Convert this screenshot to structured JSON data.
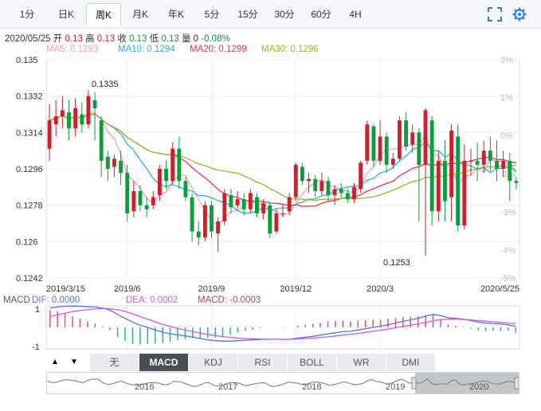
{
  "tabs": [
    {
      "label": "1分"
    },
    {
      "label": "日K"
    },
    {
      "label": "周K",
      "active": true
    },
    {
      "label": "月K"
    },
    {
      "label": "年K"
    },
    {
      "label": "5分"
    },
    {
      "label": "15分"
    },
    {
      "label": "30分"
    },
    {
      "label": "60分"
    },
    {
      "label": "4H"
    }
  ],
  "icons": {
    "fullscreen": "expand-icon",
    "settings": "gear-icon"
  },
  "info": {
    "date": "2020/05/25",
    "open_label": "开",
    "open": "0.13",
    "high_label": "高",
    "high": "0.13",
    "close_label": "收",
    "close": "0.13",
    "low_label": "低",
    "low": "0.13",
    "vol_label": "量",
    "vol": "0",
    "change": "-0.08%"
  },
  "ma_legend": [
    {
      "text": "MA5: 0.1293",
      "color": "#f0a0b8"
    },
    {
      "text": "MA10: 0.1294",
      "color": "#2bb3d9"
    },
    {
      "text": "MA20: 0.1299",
      "color": "#e0385a"
    },
    {
      "text": "MA30: 0.1296",
      "color": "#9ab82e"
    }
  ],
  "macd_legend": [
    {
      "text": "MACD",
      "color": "#555555"
    },
    {
      "text": "DIF: 0.0000",
      "color": "#5b6ee0"
    },
    {
      "text": "DEA: 0.0002",
      "color": "#d75bd6"
    },
    {
      "text": "MACD: -0.0003",
      "color": "#b5455b"
    }
  ],
  "chart_data": {
    "type": "candlestick",
    "period": "weekly",
    "ylim": [
      0.1242,
      0.135
    ],
    "y_ticks": [
      "0.135",
      "0.1332",
      "0.1314",
      "0.1296",
      "0.1278",
      "0.126",
      "0.1242"
    ],
    "pct_ticks": [
      "3%",
      "1%",
      "0%",
      "-1%",
      "-3%",
      "-4%",
      "-5%"
    ],
    "x_ticks": [
      "2019/3/15",
      "2019/6",
      "2019/9",
      "2019/12",
      "2020/3",
      "2020/5/25"
    ],
    "x_tick_index": [
      0,
      12,
      25,
      38,
      51,
      63
    ],
    "annotations": [
      {
        "text": "0.1335",
        "index": 6,
        "value": 0.1335
      },
      {
        "text": "0.1253",
        "index": 51,
        "value": 0.1253
      }
    ],
    "candles": [
      [
        0.1306,
        0.132,
        0.1328,
        0.13
      ],
      [
        0.1318,
        0.1322,
        0.133,
        0.1312
      ],
      [
        0.1322,
        0.1325,
        0.1332,
        0.1316
      ],
      [
        0.1324,
        0.1316,
        0.133,
        0.131
      ],
      [
        0.1316,
        0.1326,
        0.1331,
        0.1312
      ],
      [
        0.1323,
        0.1318,
        0.1329,
        0.1314
      ],
      [
        0.1318,
        0.1332,
        0.1335,
        0.1316
      ],
      [
        0.133,
        0.1326,
        0.1334,
        0.131
      ],
      [
        0.132,
        0.13,
        0.1322,
        0.1292
      ],
      [
        0.1302,
        0.1296,
        0.1305,
        0.129
      ],
      [
        0.1297,
        0.1301,
        0.1303,
        0.1292
      ],
      [
        0.13,
        0.1294,
        0.1305,
        0.1288
      ],
      [
        0.1294,
        0.1274,
        0.1298,
        0.127
      ],
      [
        0.1275,
        0.1285,
        0.129,
        0.1272
      ],
      [
        0.1285,
        0.1278,
        0.1288,
        0.1275
      ],
      [
        0.1278,
        0.1276,
        0.1282,
        0.1272
      ],
      [
        0.1278,
        0.1282,
        0.1285,
        0.1276
      ],
      [
        0.1283,
        0.1296,
        0.1298,
        0.128
      ],
      [
        0.1296,
        0.129,
        0.13,
        0.1286
      ],
      [
        0.129,
        0.1306,
        0.1309,
        0.1288
      ],
      [
        0.1306,
        0.129,
        0.1312,
        0.1286
      ],
      [
        0.129,
        0.1282,
        0.1292,
        0.128
      ],
      [
        0.1282,
        0.1265,
        0.1284,
        0.126
      ],
      [
        0.1265,
        0.1262,
        0.127,
        0.1258
      ],
      [
        0.1262,
        0.1278,
        0.128,
        0.126
      ],
      [
        0.1278,
        0.1265,
        0.128,
        0.1262
      ],
      [
        0.1264,
        0.127,
        0.1272,
        0.1255
      ],
      [
        0.127,
        0.1284,
        0.1286,
        0.1268
      ],
      [
        0.1283,
        0.1277,
        0.1286,
        0.1274
      ],
      [
        0.1278,
        0.1281,
        0.1285,
        0.1276
      ],
      [
        0.1281,
        0.1276,
        0.1284,
        0.1273
      ],
      [
        0.1276,
        0.1284,
        0.1286,
        0.1274
      ],
      [
        0.1282,
        0.1274,
        0.1284,
        0.1272
      ],
      [
        0.1274,
        0.1279,
        0.1281,
        0.1271
      ],
      [
        0.1278,
        0.1264,
        0.128,
        0.1262
      ],
      [
        0.1265,
        0.1274,
        0.1276,
        0.1264
      ],
      [
        0.1274,
        0.1274,
        0.1278,
        0.1272
      ],
      [
        0.1275,
        0.1282,
        0.1284,
        0.1273
      ],
      [
        0.1282,
        0.1298,
        0.1299,
        0.128
      ],
      [
        0.1297,
        0.129,
        0.1299,
        0.1288
      ],
      [
        0.129,
        0.1291,
        0.1294,
        0.1284
      ],
      [
        0.1291,
        0.1285,
        0.1293,
        0.1282
      ],
      [
        0.1285,
        0.129,
        0.1294,
        0.1283
      ],
      [
        0.129,
        0.1283,
        0.1292,
        0.128
      ],
      [
        0.1283,
        0.1286,
        0.1288,
        0.1278
      ],
      [
        0.1286,
        0.1284,
        0.1289,
        0.1282
      ],
      [
        0.1284,
        0.1281,
        0.1286,
        0.1279
      ],
      [
        0.1281,
        0.1287,
        0.1289,
        0.1279
      ],
      [
        0.1286,
        0.1299,
        0.13,
        0.1284
      ],
      [
        0.13,
        0.1318,
        0.132,
        0.1298
      ],
      [
        0.1317,
        0.13,
        0.1318,
        0.1297
      ],
      [
        0.13,
        0.1312,
        0.132,
        0.1298
      ],
      [
        0.1312,
        0.1298,
        0.1314,
        0.1294
      ],
      [
        0.1298,
        0.1301,
        0.1304,
        0.1296
      ],
      [
        0.1301,
        0.132,
        0.1322,
        0.13
      ],
      [
        0.132,
        0.1307,
        0.1324,
        0.1305
      ],
      [
        0.1308,
        0.1314,
        0.1318,
        0.1304
      ],
      [
        0.1314,
        0.1298,
        0.1316,
        0.127
      ],
      [
        0.1298,
        0.1325,
        0.1326,
        0.1253
      ],
      [
        0.132,
        0.1275,
        0.1322,
        0.1268
      ],
      [
        0.1275,
        0.13,
        0.1305,
        0.127
      ],
      [
        0.13,
        0.128,
        0.131,
        0.127
      ],
      [
        0.1282,
        0.1315,
        0.1318,
        0.127
      ],
      [
        0.1312,
        0.1268,
        0.1318,
        0.1265
      ],
      [
        0.1268,
        0.13,
        0.1308,
        0.1266
      ],
      [
        0.13,
        0.13,
        0.1306,
        0.1293
      ],
      [
        0.13,
        0.1298,
        0.1309,
        0.129
      ],
      [
        0.1298,
        0.1305,
        0.131,
        0.1294
      ],
      [
        0.1305,
        0.13,
        0.1312,
        0.1295
      ],
      [
        0.13,
        0.1296,
        0.131,
        0.129
      ],
      [
        0.1296,
        0.13,
        0.1305,
        0.1292
      ],
      [
        0.13,
        0.129,
        0.1304,
        0.128
      ],
      [
        0.129,
        0.1289,
        0.1292,
        0.1286
      ]
    ],
    "macd": {
      "ylim": [
        -1,
        1
      ],
      "y_ticks": [
        "1",
        "-1"
      ],
      "dif": [
        0.9,
        0.95,
        0.98,
        0.99,
        0.98,
        0.96,
        0.95,
        0.9,
        0.8,
        0.6,
        0.42,
        0.25,
        0.1,
        0.0,
        -0.12,
        -0.22,
        -0.3,
        -0.35,
        -0.4,
        -0.45,
        -0.52,
        -0.58,
        -0.62,
        -0.64,
        -0.64,
        -0.62,
        -0.6,
        -0.58,
        -0.56,
        -0.55,
        -0.55,
        -0.56,
        -0.55,
        -0.5,
        -0.46,
        -0.42,
        -0.36,
        -0.3,
        -0.25,
        -0.2,
        -0.18,
        -0.12,
        -0.06,
        0.0,
        0.05,
        0.12,
        0.2,
        0.28,
        0.35,
        0.42,
        0.52,
        0.6,
        0.55,
        0.45,
        0.42,
        0.38,
        0.32,
        0.25,
        0.2,
        0.18,
        0.15,
        0.12,
        0.05
      ],
      "dea": [
        0.5,
        0.58,
        0.66,
        0.73,
        0.78,
        0.82,
        0.86,
        0.88,
        0.86,
        0.82,
        0.74,
        0.63,
        0.5,
        0.38,
        0.26,
        0.14,
        0.04,
        -0.05,
        -0.13,
        -0.2,
        -0.27,
        -0.33,
        -0.38,
        -0.43,
        -0.47,
        -0.5,
        -0.52,
        -0.53,
        -0.54,
        -0.55,
        -0.55,
        -0.55,
        -0.55,
        -0.54,
        -0.52,
        -0.5,
        -0.47,
        -0.44,
        -0.4,
        -0.36,
        -0.32,
        -0.28,
        -0.23,
        -0.18,
        -0.13,
        -0.08,
        -0.02,
        0.04,
        0.1,
        0.16,
        0.23,
        0.3,
        0.36,
        0.38,
        0.38,
        0.37,
        0.35,
        0.32,
        0.29,
        0.26,
        0.23,
        0.2,
        0.18
      ]
    }
  },
  "indicator_buttons": [
    {
      "label": "无"
    },
    {
      "label": "MACD",
      "active": true
    },
    {
      "label": "KDJ"
    },
    {
      "label": "RSI"
    },
    {
      "label": "BOLL"
    },
    {
      "label": "WR"
    },
    {
      "label": "DMI"
    }
  ],
  "nav_arrows": {
    "prev": "▲",
    "next": "▼"
  },
  "navigator": {
    "years": [
      "2016",
      "2017",
      "2018",
      "2019",
      "2020"
    ]
  },
  "colors": {
    "up": "#d01f2b",
    "down": "#0a9e3a",
    "grid": "#e8ecf0",
    "axis_text": "#333333",
    "pct_text": "#bbbbbb"
  }
}
